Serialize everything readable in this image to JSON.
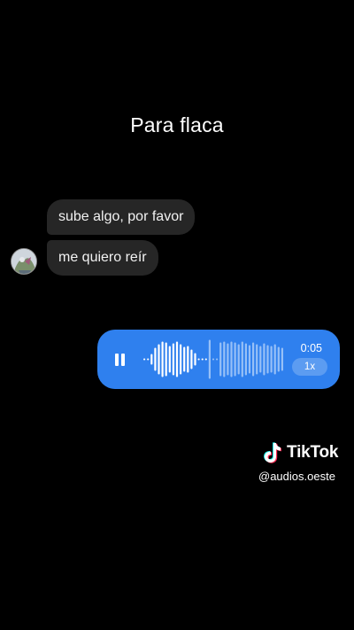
{
  "caption": "Para flaca",
  "chat": {
    "received": [
      {
        "text": "sube algo, por favor"
      },
      {
        "text": "me quiero reír"
      }
    ],
    "avatar_icon": "profile-avatar"
  },
  "voice_message": {
    "state_icon": "pause-icon",
    "duration": "0:05",
    "playback_speed": "1x",
    "progress": 0.45,
    "bubble_color": "#2f80ee"
  },
  "watermark": {
    "brand": "TikTok",
    "handle": "@audios.oeste",
    "logo_icon": "tiktok-logo-icon"
  },
  "colors": {
    "background": "#000000",
    "received_bubble": "#262626",
    "accent": "#2f80ee"
  }
}
